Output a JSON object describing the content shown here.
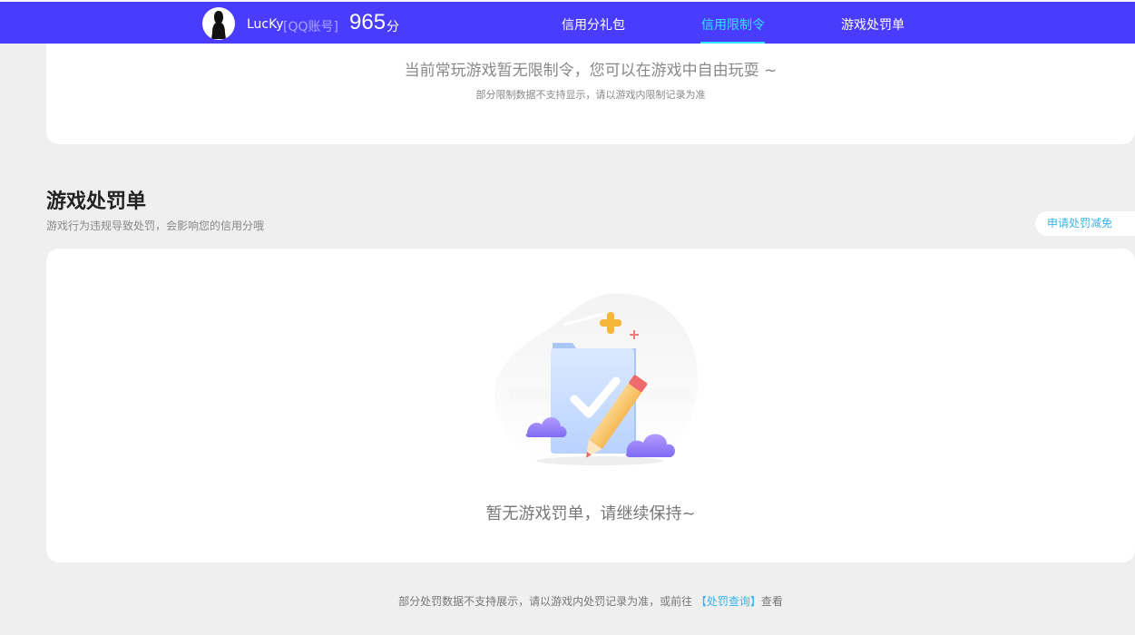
{
  "header": {
    "username": "LucKy",
    "account_tag": "[QQ账号]",
    "score": "965",
    "score_unit": "分",
    "nav": [
      {
        "label": "信用分礼包",
        "active": false
      },
      {
        "label": "信用限制令",
        "active": true
      },
      {
        "label": "游戏处罚单",
        "active": false
      }
    ]
  },
  "restriction": {
    "message": "当前常玩游戏暂无限制令，您可以在游戏中自由玩耍 ~",
    "note": "部分限制数据不支持显示，请以游戏内限制记录为准"
  },
  "penalty": {
    "title": "游戏处罚单",
    "subtitle": "游戏行为违规导致处罚，会影响您的信用分哦",
    "apply_button": "申请处罚减免",
    "empty_message": "暂无游戏罚单，请继续保持~"
  },
  "footer": {
    "text_before": "部分处罚数据不支持展示，请以游戏内处罚记录为准，或前往 ",
    "link_text": "【处罚查询】",
    "text_after": "查看"
  },
  "colors": {
    "header_bg": "#4a3cff",
    "active_nav": "#38e3ff",
    "link": "#3ab4e8"
  }
}
